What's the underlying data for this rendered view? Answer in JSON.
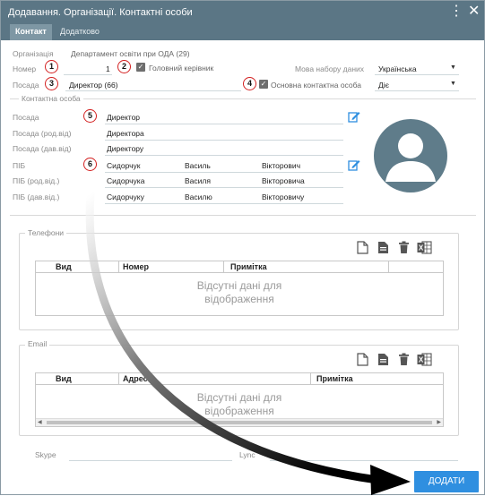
{
  "window": {
    "title": "Додавання. Організації. Контактні особи",
    "colors": {
      "titlebar": "#5b7685",
      "accent": "#2f8fe0",
      "badge_border": "#d32121",
      "avatar": "#5f7c8a"
    }
  },
  "tabs": [
    {
      "label": "Контакт",
      "active": true
    },
    {
      "label": "Додатково",
      "active": false
    }
  ],
  "form": {
    "organization_label": "Організація",
    "organization_value": "Департамент освіти при ОДА (29)",
    "number_label": "Номер",
    "number_value": "1",
    "head_label": "Головний керівник",
    "head_checked": true,
    "language_label": "Мова набору даних",
    "language_value": "Українська",
    "position_label": "Посада",
    "position_value": "Директор (66)",
    "main_contact_label": "Основна контактна особа",
    "main_contact_checked": true,
    "main_contact_value": "Діє"
  },
  "contact_person": {
    "section_label": "Контактна особа",
    "position_label": "Посада",
    "position_value": "Директор",
    "position_gen_label": "Посада (род.від)",
    "position_gen_value": "Директора",
    "position_dat_label": "Посада (дав.від)",
    "position_dat_value": "Директору",
    "name_label": "ПІБ",
    "name": [
      "Сидорчук",
      "Василь",
      "Вікторович"
    ],
    "name_gen_label": "ПІБ (род.від.)",
    "name_gen": [
      "Сидорчука",
      "Василя",
      "Вікторовича"
    ],
    "name_dat_label": "ПІБ (дав.від.)",
    "name_dat": [
      "Сидорчуку",
      "Василю",
      "Вікторовичу"
    ]
  },
  "badges": [
    "1",
    "2",
    "3",
    "4",
    "5",
    "6"
  ],
  "phones": {
    "legend": "Телефони",
    "columns": [
      "Вид",
      "Номер",
      "Примітка"
    ],
    "empty_text_line1": "Відсутні дані для",
    "empty_text_line2": "відображення",
    "tools": [
      "new-file-icon",
      "document-icon",
      "trash-icon",
      "excel-icon"
    ]
  },
  "email": {
    "legend": "Email",
    "columns": [
      "Вид",
      "Адреса",
      "Примітка"
    ],
    "empty_text_line1": "Відсутні дані для",
    "empty_text_line2": "відображення",
    "tools": [
      "new-file-icon",
      "document-icon",
      "trash-icon",
      "excel-icon"
    ]
  },
  "footer": {
    "skype_label": "Skype",
    "lync_label": "Lync",
    "add_button": "ДОДАТИ"
  }
}
